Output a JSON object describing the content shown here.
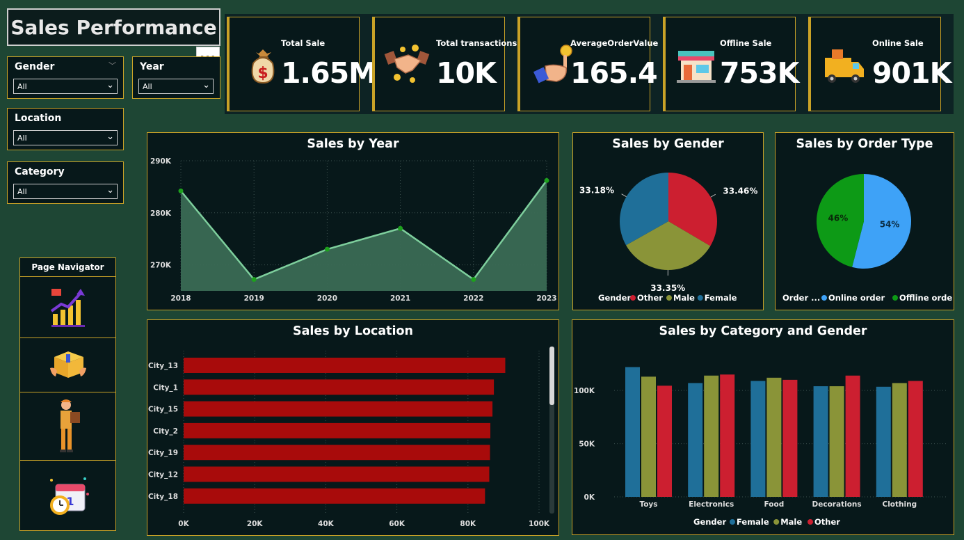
{
  "header": {
    "title": "Sales Performance",
    "more_icon": "more-options-icon",
    "more_label": "···"
  },
  "filters": {
    "gender": {
      "label": "Gender",
      "value": "All"
    },
    "year": {
      "label": "Year",
      "value": "All"
    },
    "location": {
      "label": "Location",
      "value": "All"
    },
    "category": {
      "label": "Category",
      "value": "All"
    }
  },
  "kpis": [
    {
      "label": "Total Sale",
      "value": "1.65M",
      "icon": "money-bag-icon"
    },
    {
      "label": "Total transactions",
      "value": "10K",
      "icon": "handshake-icon"
    },
    {
      "label": "AverageOrderValue",
      "value": "165.4",
      "icon": "coin-hand-icon"
    },
    {
      "label": "Offline Sale",
      "value": "753K",
      "icon": "store-icon"
    },
    {
      "label": "Online Sale",
      "value": "901K",
      "icon": "delivery-van-icon"
    }
  ],
  "navigator": {
    "title": "Page Navigator",
    "items": [
      {
        "icon": "growth-chart-icon"
      },
      {
        "icon": "package-box-icon"
      },
      {
        "icon": "delivery-person-icon"
      },
      {
        "icon": "calendar-clock-icon"
      }
    ]
  },
  "colors": {
    "accent_border": "#c9a227",
    "female": "#1f6f99",
    "male": "#8a9438",
    "other": "#cc1f30",
    "online": "#3ea2f7",
    "offline": "#0d9a16",
    "location_bar": "#a80b0b",
    "line": "#7ecf9d"
  },
  "chart_data": [
    {
      "type": "area",
      "title": "Sales by Year",
      "x": [
        "2018",
        "2019",
        "2020",
        "2021",
        "2022",
        "2023"
      ],
      "values": [
        284200,
        267200,
        273000,
        277000,
        267200,
        286200
      ],
      "ylim": [
        265000,
        290000
      ],
      "yticks": [
        "270K",
        "280K",
        "290K"
      ],
      "grid": true
    },
    {
      "type": "pie",
      "title": "Sales by Gender",
      "legend_title": "Gender",
      "slices": [
        {
          "name": "Other",
          "value": 33.46,
          "label": "33.46%"
        },
        {
          "name": "Male",
          "value": 33.35,
          "label": "33.35%"
        },
        {
          "name": "Female",
          "value": 33.18,
          "label": "33.18%"
        }
      ]
    },
    {
      "type": "pie",
      "title": "Sales by Order Type",
      "legend_title": "Order ...",
      "slices": [
        {
          "name": "Online order",
          "value": 54,
          "label": "54%"
        },
        {
          "name": "Offline order",
          "value": 46,
          "label": "46%"
        }
      ]
    },
    {
      "type": "bar",
      "orientation": "horizontal",
      "title": "Sales by Location",
      "categories": [
        "City_13",
        "City_1",
        "City_15",
        "City_2",
        "City_19",
        "City_12",
        "City_18"
      ],
      "values": [
        90500,
        87300,
        86900,
        86300,
        86200,
        86000,
        84800
      ],
      "xlim": [
        0,
        100000
      ],
      "xticks": [
        "0K",
        "20K",
        "40K",
        "60K",
        "80K",
        "100K"
      ],
      "grid": true
    },
    {
      "type": "bar",
      "title": "Sales by Category and Gender",
      "categories": [
        "Toys",
        "Electronics",
        "Food",
        "Decorations",
        "Clothing"
      ],
      "legend_title": "Gender",
      "series": [
        {
          "name": "Female",
          "values": [
            122000,
            107000,
            109000,
            104000,
            103500
          ]
        },
        {
          "name": "Male",
          "values": [
            113000,
            114000,
            112000,
            104000,
            107000
          ]
        },
        {
          "name": "Other",
          "values": [
            104500,
            115000,
            110000,
            114000,
            109000
          ]
        }
      ],
      "ylim": [
        0,
        140000
      ],
      "yticks": [
        "0K",
        "50K",
        "100K"
      ],
      "grid": true
    }
  ]
}
